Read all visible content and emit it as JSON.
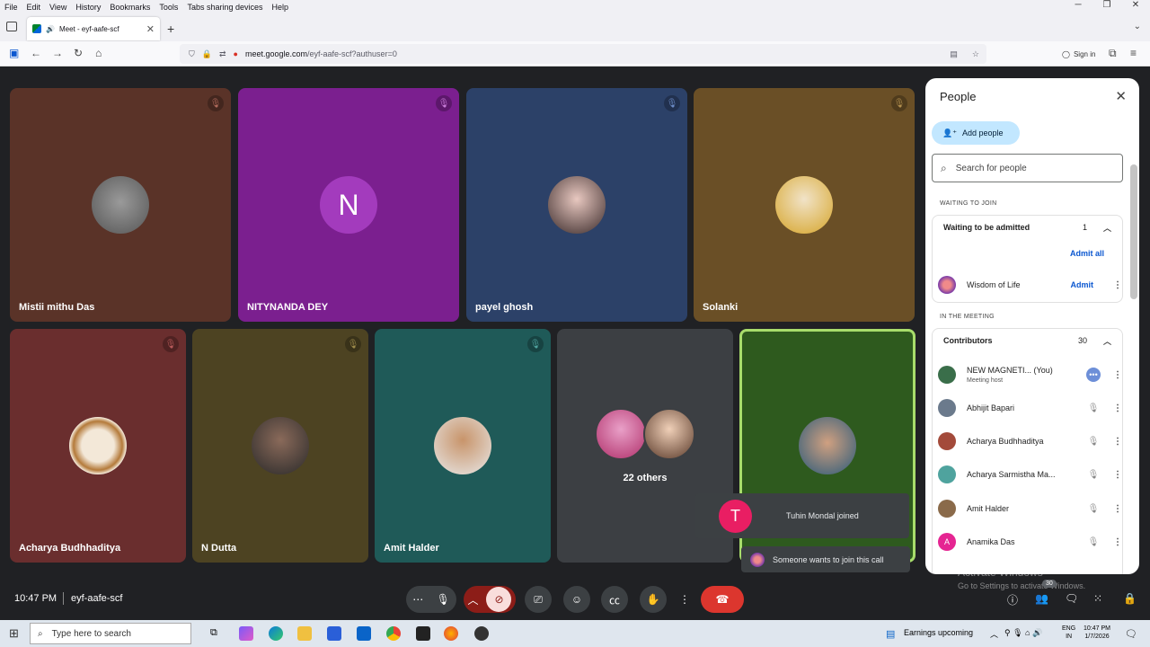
{
  "browser": {
    "menu": [
      "File",
      "Edit",
      "View",
      "History",
      "Bookmarks",
      "Tools",
      "Tabs sharing devices",
      "Help"
    ],
    "tab_title": "Meet - eyf-aafe-scf",
    "url_host": "meet.google.com",
    "url_path": "/eyf-aafe-scf?authuser=0",
    "signin_label": "Sign in"
  },
  "tiles": [
    {
      "name": "Mistii mithu Das",
      "bg": "#5a3328",
      "mute_color": "#b06a5c"
    },
    {
      "name": "NITYNANDA DEY",
      "bg": "#7b1f8f",
      "avatar_letter": "N",
      "avatar_bg": "#a33bbd",
      "mute_color": "#c87bd8"
    },
    {
      "name": "payel ghosh",
      "bg": "#2c4168",
      "mute_color": "#6b8ac4"
    },
    {
      "name": "Solanki",
      "bg": "#6a4f26",
      "mute_color": "#b3904f"
    },
    {
      "name": "Acharya Budhhaditya",
      "bg": "#6a2e2e",
      "mute_color": "#b85a5a"
    },
    {
      "name": "N Dutta",
      "bg": "#4d4322",
      "mute_color": "#9c8a4a"
    },
    {
      "name": "Amit Halder",
      "bg": "#1f5a58",
      "mute_color": "#4fa39e"
    },
    {
      "name": "22 others",
      "bg": "#3c3f43"
    },
    {
      "name": "",
      "bg": "#2e5a1e",
      "border": "#a8dd6b"
    }
  ],
  "people_panel": {
    "title": "People",
    "add_people": "Add people",
    "search_placeholder": "Search for people",
    "waiting_section": "WAITING TO JOIN",
    "waiting_group": "Waiting to be admitted",
    "waiting_count": "1",
    "admit_all": "Admit all",
    "waiting_person": "Wisdom of Life",
    "admit": "Admit",
    "meeting_section": "IN THE MEETING",
    "contributors": "Contributors",
    "contributors_count": "30",
    "participants": [
      {
        "name": "NEW MAGNETI...",
        "you": "(You)",
        "sub": "Meeting host",
        "color": "#3a6e4a"
      },
      {
        "name": "Abhijit Bapari",
        "color": "#6b7a8c"
      },
      {
        "name": "Acharya Budhhaditya",
        "color": "#a34a3a"
      },
      {
        "name": "Acharya Sarmistha Ma...",
        "color": "#4fa39e"
      },
      {
        "name": "Amit Halder",
        "color": "#8a6a4a"
      },
      {
        "name": "Anamika Das",
        "letter": "A",
        "color": "#e52592"
      }
    ]
  },
  "toasts": {
    "joined_letter": "T",
    "joined": "Tuhin Mondal joined",
    "wants_to_join": "Someone wants to join this call"
  },
  "bottombar": {
    "time": "10:47 PM",
    "meeting_code": "eyf-aafe-scf",
    "people_badge": "30",
    "activate_title": "Activate Windows",
    "activate_sub": "Go to Settings to activate Windows."
  },
  "taskbar": {
    "search_placeholder": "Type here to search",
    "news": "Earnings upcoming",
    "lang": "ENG",
    "region": "IN",
    "time": "10:47 PM",
    "date": "1/7/2026"
  }
}
